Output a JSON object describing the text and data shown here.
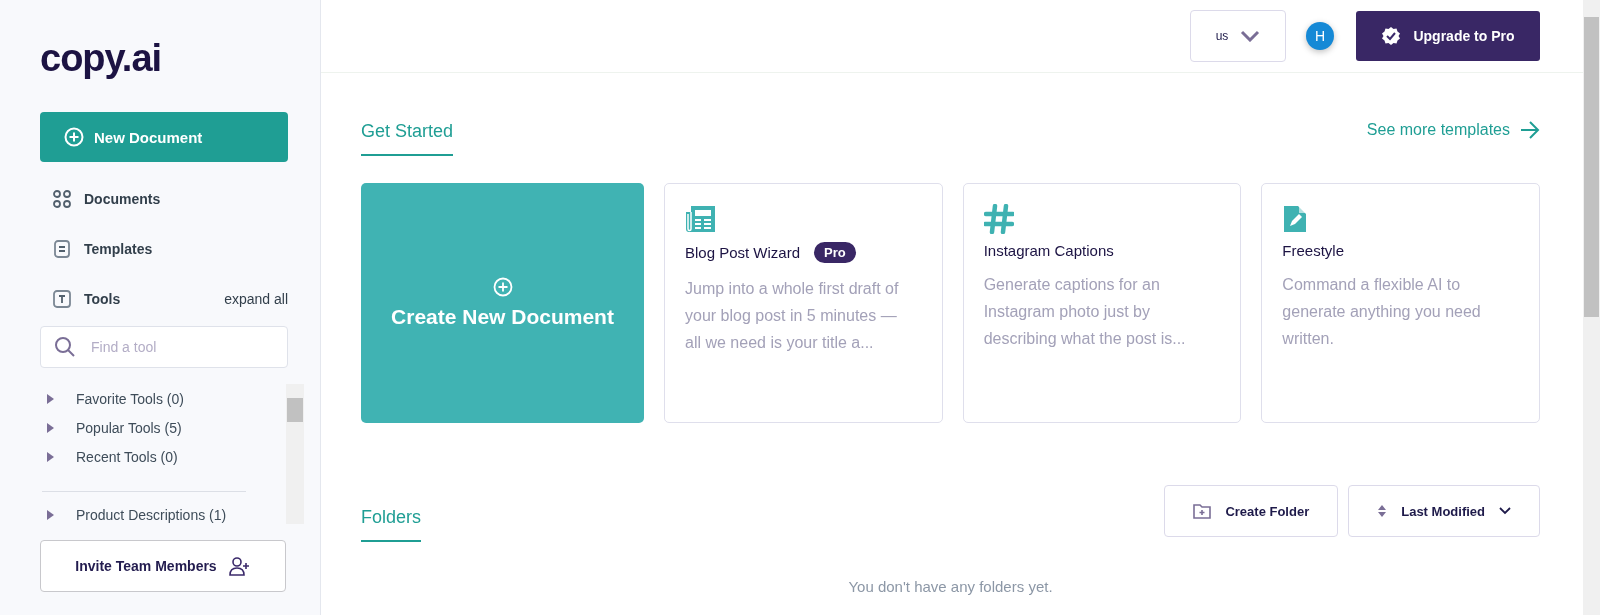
{
  "sidebar": {
    "logo": "copy.ai",
    "new_button": "New Document",
    "nav": [
      {
        "label": "Documents",
        "selected": false
      },
      {
        "label": "Templates",
        "selected": false
      },
      {
        "label": "Tools",
        "selected": false,
        "action": "expand all"
      }
    ],
    "search": {
      "placeholder": "Find a tool"
    },
    "tool_groups": [
      [
        {
          "label": "Favorite Tools (0)",
          "expanded": false
        },
        {
          "label": "Popular Tools (5)",
          "expanded": false
        },
        {
          "label": "Recent Tools (0)",
          "expanded": false
        }
      ],
      [
        {
          "label": "Product Descriptions (1)",
          "expanded": false
        }
      ]
    ],
    "invite_button": "Invite Team Members"
  },
  "header": {
    "region": "us",
    "avatar": "H",
    "upgrade_button": "Upgrade to Pro"
  },
  "get_started": {
    "tabs": [
      {
        "label": "Get Started",
        "selected": true
      }
    ],
    "more_link": "See more templates",
    "create_card": "Create New Document",
    "templates": [
      {
        "title": "Blog Post Wizard",
        "badge": "Pro",
        "description": "Jump into a whole first draft of your blog post in 5 minutes — all we need is your title a..."
      },
      {
        "title": "Instagram Captions",
        "description": "Generate captions for an Instagram photo just by describing what the post is..."
      },
      {
        "title": "Freestyle",
        "description": "Command a flexible AI to generate anything you need written."
      }
    ]
  },
  "folders": {
    "tabs": [
      {
        "label": "Folders",
        "selected": true
      }
    ],
    "create_button": "Create Folder",
    "sort_button": "Last Modified",
    "empty_text": "You don't have any folders yet."
  }
}
